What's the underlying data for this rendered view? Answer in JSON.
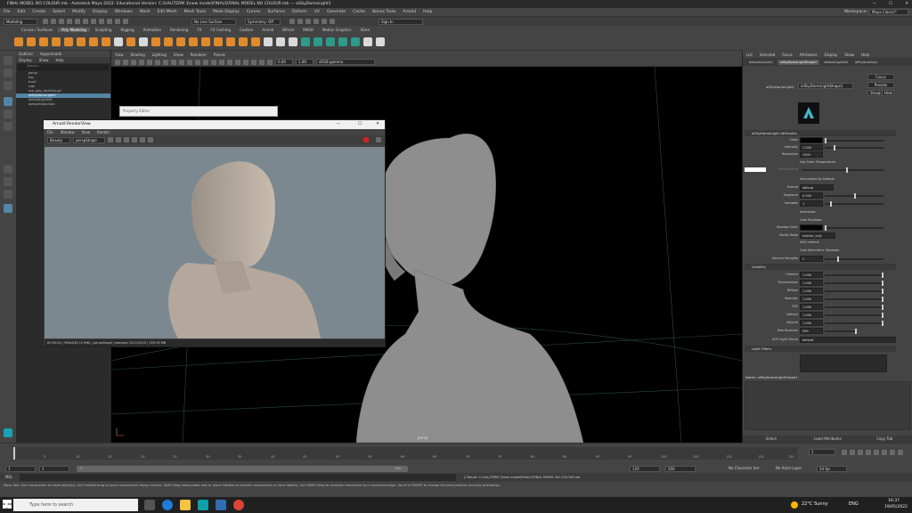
{
  "window": {
    "title": "FINAL MODEL NO COLOUR.mb - Autodesk Maya 2022: Educational Version: C:\\UAL\\TERM 3\\new model\\FINALS\\FINAL MODEL NO COLOUR.mb --- aiSkyDomeLight1",
    "controls": [
      "—",
      "☐",
      "✕"
    ]
  },
  "menubar": [
    "File",
    "Edit",
    "Create",
    "Select",
    "Modify",
    "Display",
    "Windows",
    "Mesh",
    "Edit Mesh",
    "Mesh Tools",
    "Mesh Display",
    "Curves",
    "Surfaces",
    "Deform",
    "UV",
    "Generate",
    "Cache",
    "Bonus Tools",
    "Arnold",
    "Help"
  ],
  "workspace": {
    "label": "Workspace:",
    "value": "Maya Classic*"
  },
  "status_line": {
    "mode": "Modeling",
    "live_surface": "No Live Surface",
    "symmetry": "Symmetry: Off",
    "sign_in": "Sign In"
  },
  "shelf_tabs": [
    "Curves / Surfaces",
    "Poly Modeling",
    "Sculpting",
    "Rigging",
    "Animation",
    "Rendering",
    "FX",
    "FX Caching",
    "Custom",
    "Arnold",
    "Bifrost",
    "MASH",
    "Motion Graphics",
    "XGen"
  ],
  "shelf_tab_active": "Poly Modeling",
  "outliner": {
    "menu": [
      "Outliner",
      "Hypershade"
    ],
    "sub_menu": [
      "Display",
      "Show",
      "Help"
    ],
    "search_placeholder": "Search...",
    "items": [
      "persp",
      "top",
      "front",
      "side",
      "low_poly_faceGroup2",
      "aiSkyDomeLight1",
      "defaultLightSet",
      "defaultObjectSet"
    ],
    "selected_index": 5
  },
  "viewport": {
    "menu": [
      "View",
      "Shading",
      "Lighting",
      "Show",
      "Renderer",
      "Panels"
    ],
    "field1": "0.00",
    "field2": "1.00",
    "color_space": "sRGB gamma",
    "camera_label": "persp"
  },
  "property_editor": {
    "title": "Property Editor"
  },
  "render_view": {
    "title": "Arnold RenderView",
    "controls": [
      "—",
      "☐",
      "✕"
    ],
    "menu": [
      "File",
      "Window",
      "View",
      "Render"
    ],
    "combo1": "Beauty",
    "combo2": "perspShape",
    "status": "00:00:04 | 960x540 (1:996) | perspShape | samples 3/2/2/2/2/2 | 303.95 MB"
  },
  "attribute_editor": {
    "menu": [
      "List",
      "Selected",
      "Focus",
      "Attributes",
      "Display",
      "Show",
      "Help"
    ],
    "tabs": [
      "defaultArnoldLi",
      "aiSkyDomeLightShape1",
      "defaultLightSet",
      "aiPhysicalSky1"
    ],
    "active_tab_index": 1,
    "node_label": "aiSkyDomeLight:",
    "node_value": "aiSkyDomeLightShape1",
    "buttons": [
      "Focus",
      "Presets",
      "Show",
      "Hide"
    ],
    "section_attrs": "aiSkyDomeLight Attributes",
    "attrs": [
      {
        "label": "Color",
        "value": ""
      },
      {
        "label": "Intensity",
        "value": "1.000"
      },
      {
        "label": "Resolution",
        "value": "1000"
      },
      {
        "label": "Temperature",
        "value": ""
      },
      {
        "label": "Format",
        "value": "latlong"
      },
      {
        "label": "Exposure",
        "value": "0.000"
      },
      {
        "label": "Samples",
        "value": "1"
      },
      {
        "label": "Shadow Color",
        "value": ""
      },
      {
        "label": "Portal Mode",
        "value": "interior_only"
      },
      {
        "label": "Volume Samples",
        "value": "2"
      }
    ],
    "checks": [
      "Use Color Temperature",
      "Illuminates By Default",
      "Normalize",
      "Cast Shadows",
      "AOV Indirect",
      "Cast Volumetric Shadows"
    ],
    "section_visibility": "Visibility",
    "visibility": [
      {
        "label": "Camera",
        "value": "1.000"
      },
      {
        "label": "Transmission",
        "value": "1.000"
      },
      {
        "label": "Diffuse",
        "value": "1.000"
      },
      {
        "label": "Specular",
        "value": "1.000"
      },
      {
        "label": "SSS",
        "value": "1.000"
      },
      {
        "label": "Indirect",
        "value": "1.000"
      },
      {
        "label": "Volume",
        "value": "1.000"
      },
      {
        "label": "Max Bounces",
        "value": "999"
      }
    ],
    "aov_label": "AOV Light Group",
    "aov_value": "default",
    "section_filters": "Light Filters",
    "notes": "Notes: aiSkyDomeLightShape1",
    "bottom": [
      "Select",
      "Load Attributes",
      "Copy Tab"
    ]
  },
  "time_slider": {
    "start": "1",
    "current": "1",
    "ticks": [
      "5",
      "10",
      "15",
      "20",
      "25",
      "30",
      "35",
      "40",
      "45",
      "50",
      "55",
      "60",
      "65",
      "70",
      "75",
      "80",
      "85",
      "90",
      "95",
      "100",
      "105",
      "110",
      "115",
      "120"
    ]
  },
  "range": {
    "start": "1",
    "inner_start": "1",
    "slider_mid": "120",
    "inner_end": "120",
    "end": "200",
    "character_set": "No Character Set",
    "anim_layer": "No Anim Layer",
    "fps": "24 fps"
  },
  "mel": {
    "label": "MEL",
    "result": "// Result: C:/UAL/TERM 3/new model/FINALS/FINAL MODEL NO COLOUR.mb"
  },
  "help_line": "Move Tool: Use manipulator to move object(s). Ctrl+middle-drag to move components along normals. Shift+drag manipulator axis or plane handles to extrude components or clone objects. Ctrl+Shift+drag to constrain movement to a connected edge. Use D or INSERT to change the pivot position and axis orientation.",
  "taskbar": {
    "search_placeholder": "Type here to search",
    "weather": "22°C  Sunny",
    "lang": "ENG",
    "time": "16:37",
    "date": "19/05/2022"
  }
}
